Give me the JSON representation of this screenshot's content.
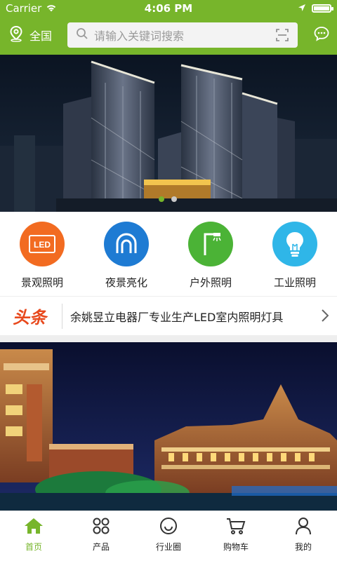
{
  "status_bar": {
    "carrier": "Carrier",
    "time": "4:06 PM"
  },
  "header": {
    "location_label": "全国",
    "search_placeholder": "请输入关键词搜索",
    "icons": {
      "location": "location-pin-icon",
      "search": "search-icon",
      "scan": "scan-icon",
      "chat": "chat-icon"
    }
  },
  "banner": {
    "total_slides": 2,
    "active_slide": 1
  },
  "categories": [
    {
      "label": "景观照明",
      "icon": "led-icon",
      "color": "#f26b21"
    },
    {
      "label": "夜景亮化",
      "icon": "arch-icon",
      "color": "#1e7bd3"
    },
    {
      "label": "户外照明",
      "icon": "street-lamp-icon",
      "color": "#4bb336"
    },
    {
      "label": "工业照明",
      "icon": "bulb-icon",
      "color": "#2fb6e8"
    }
  ],
  "categories_led_text": "LED",
  "news": {
    "tag": "头条",
    "headline": "余姚昱立电器厂专业生产LED室内照明灯具"
  },
  "tabs": [
    {
      "label": "首页",
      "icon": "home-icon",
      "active": true
    },
    {
      "label": "产品",
      "icon": "grid-icon",
      "active": false
    },
    {
      "label": "行业圈",
      "icon": "circle-smile-icon",
      "active": false
    },
    {
      "label": "购物车",
      "icon": "cart-icon",
      "active": false
    },
    {
      "label": "我的",
      "icon": "user-icon",
      "active": false
    }
  ],
  "colors": {
    "brand": "#77b52b",
    "headline_tag": "#e8491d"
  }
}
